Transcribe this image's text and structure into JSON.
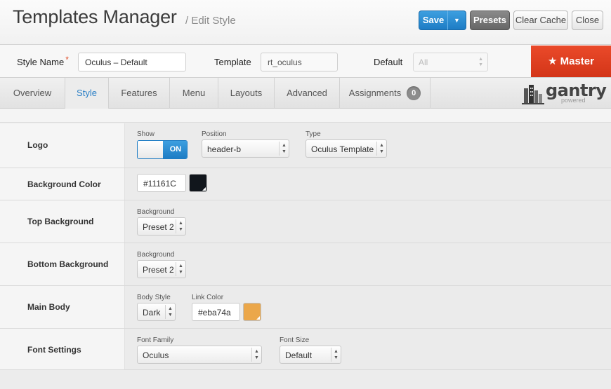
{
  "header": {
    "title": "Templates Manager",
    "subtitle": "/ Edit Style",
    "buttons": {
      "save": "Save",
      "presets": "Presets",
      "clear_cache": "Clear Cache",
      "close": "Close"
    }
  },
  "stylebar": {
    "style_name_label": "Style Name",
    "required_mark": "*",
    "style_name_value": "Oculus – Default",
    "template_label": "Template",
    "template_value": "rt_oculus",
    "default_label": "Default",
    "default_value": "All",
    "master_label": "★ Master"
  },
  "tabs": [
    {
      "label": "Overview"
    },
    {
      "label": "Style",
      "active": true
    },
    {
      "label": "Features"
    },
    {
      "label": "Menu"
    },
    {
      "label": "Layouts"
    },
    {
      "label": "Advanced"
    },
    {
      "label": "Assignments",
      "badge": "0"
    }
  ],
  "brand": {
    "name": "gantry",
    "sub": "powered"
  },
  "rows": {
    "logo": {
      "label": "Logo",
      "show_label": "Show",
      "toggle_on": "ON",
      "position_label": "Position",
      "position_value": "header-b",
      "type_label": "Type",
      "type_value": "Oculus Template"
    },
    "bg_color": {
      "label": "Background Color",
      "value": "#11161C",
      "swatch": "#11161c"
    },
    "top_bg": {
      "label": "Top Background",
      "field_label": "Background",
      "value": "Preset 2"
    },
    "bottom_bg": {
      "label": "Bottom Background",
      "field_label": "Background",
      "value": "Preset 2"
    },
    "main_body": {
      "label": "Main Body",
      "body_style_label": "Body Style",
      "body_style_value": "Dark",
      "link_color_label": "Link Color",
      "link_color_value": "#eba74a",
      "swatch": "#eba74a"
    },
    "font": {
      "label": "Font Settings",
      "family_label": "Font Family",
      "family_value": "Oculus",
      "size_label": "Font Size",
      "size_value": "Default"
    }
  },
  "colors": {
    "accent": "#2a7fc6",
    "master": "#e0442a"
  }
}
